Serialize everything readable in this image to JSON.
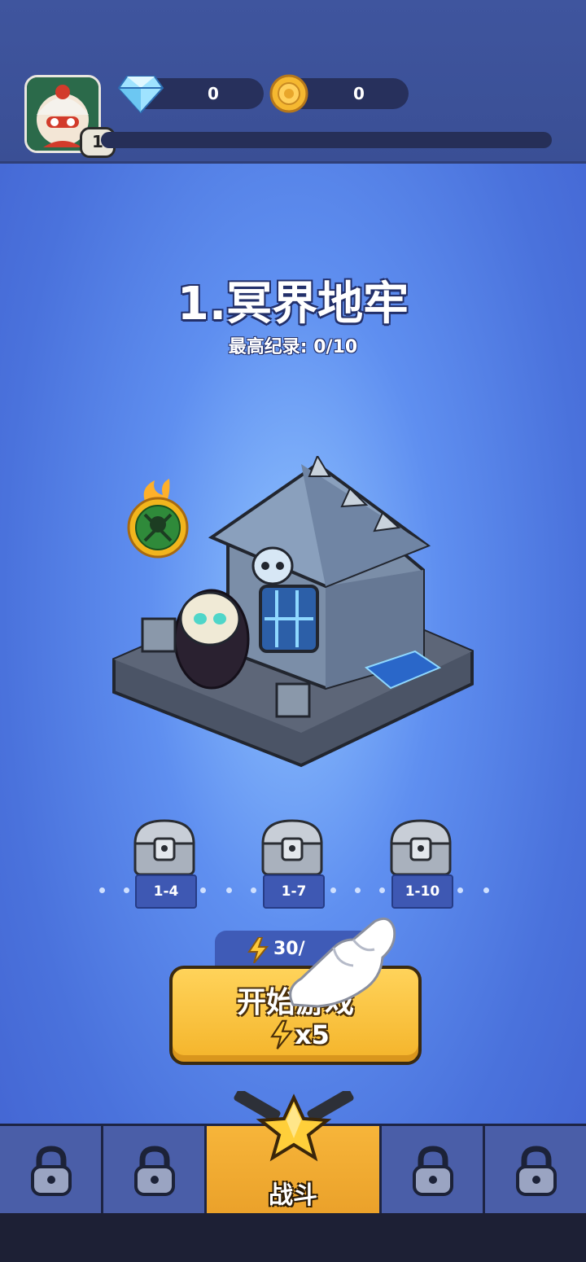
{
  "header": {
    "player_level": "1",
    "gems": "0",
    "coins": "0"
  },
  "stage": {
    "title": "1.冥界地牢",
    "record": "最高纪录: 0/10"
  },
  "chests": [
    {
      "label": "1-4"
    },
    {
      "label": "1-7"
    },
    {
      "label": "1-10"
    }
  ],
  "energy": {
    "text": "30/"
  },
  "start_button": {
    "label": "开始游戏",
    "cost": "x5"
  },
  "bottom_nav": {
    "battle_label": "战斗"
  },
  "colors": {
    "background": "#5f8ff0",
    "topbar": "#3f559e",
    "button": "#f4b42a",
    "nav_active": "#f7b53a"
  }
}
